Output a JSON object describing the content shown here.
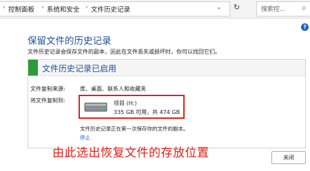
{
  "address_bar": {
    "breadcrumbs": [
      "控制面板",
      "系统和安全",
      "文件历史记录"
    ],
    "search_placeholder": "搜索控..."
  },
  "help_label": "?",
  "page": {
    "title": "保留文件的历史记录",
    "description": "文件历史记录会保存文件的副本，因此在文件丢失或损坏时，你可以找回它们。"
  },
  "status": {
    "text": "文件历史记录已启用",
    "color": "#2d9a3c"
  },
  "details": {
    "source_label": "文件复制来源:",
    "source_value": "库、桌面、联系人和收藏夹",
    "dest_label": "将文件复制到:"
  },
  "drive": {
    "icon": "drive-icon",
    "name": "项目 (H:)",
    "space": "335 GB 可用，共 474 GB"
  },
  "copy_note": "文件历史记录正在第一次保存你的文件的副本。",
  "stop_link": "停止",
  "annotation": {
    "text": "由此选出恢复文件的存放位置",
    "color": "#e0201a"
  },
  "close_button": "关闭"
}
